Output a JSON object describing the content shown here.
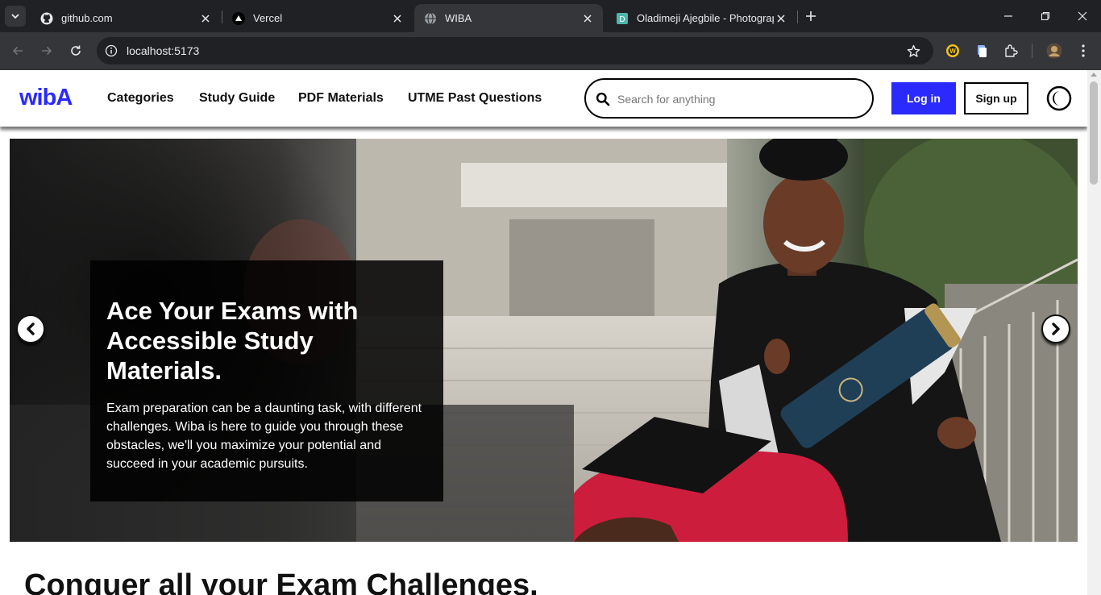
{
  "browser": {
    "tabs": [
      {
        "title": "github.com",
        "icon": "github-icon",
        "active": false
      },
      {
        "title": "Vercel",
        "icon": "vercel-icon",
        "active": false
      },
      {
        "title": "WIBA",
        "icon": "globe-icon",
        "active": true
      },
      {
        "title": "Oladimeji Ajegbile - Photograp",
        "icon": "doc-icon",
        "active": false
      }
    ],
    "url": "localhost:5173",
    "colors": {
      "frame": "#202124",
      "toolbar": "#35363a"
    }
  },
  "header": {
    "logo_text": "wibA",
    "nav": [
      "Categories",
      "Study Guide",
      "PDF Materials",
      "UTME Past Questions"
    ],
    "search_placeholder": "Search for anything",
    "login_label": "Log in",
    "signup_label": "Sign up",
    "colors": {
      "brand": "#2a2aff"
    }
  },
  "hero": {
    "headline": "Ace Your Exams with Accessible Study Materials.",
    "body": "Exam preparation can be a daunting task, with different challenges. Wiba is here to guide you through these obstacles, we'll you maximize your potential and succeed in your academic pursuits."
  },
  "section": {
    "title": "Conquer all your Exam Challenges."
  }
}
